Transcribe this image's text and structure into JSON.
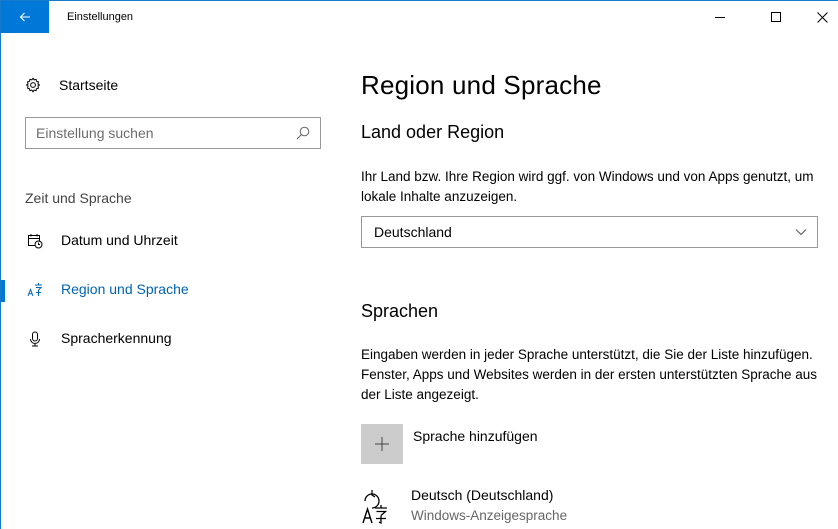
{
  "window": {
    "title": "Einstellungen",
    "accent_color": "#0078d7"
  },
  "icons": {
    "back": "back-arrow-icon",
    "home": "gear-icon",
    "search": "search-icon",
    "date": "calendar-clock-icon",
    "region": "language-region-icon",
    "speech": "microphone-icon",
    "add": "plus-icon",
    "dropdown": "chevron-down-icon",
    "language": "language-display-icon"
  },
  "sidebar": {
    "home_label": "Startseite",
    "search_placeholder": "Einstellung suchen",
    "section_label": "Zeit und Sprache",
    "items": [
      {
        "label": "Datum und Uhrzeit",
        "active": false
      },
      {
        "label": "Region und Sprache",
        "active": true
      },
      {
        "label": "Spracherkennung",
        "active": false
      }
    ]
  },
  "main": {
    "title": "Region und Sprache",
    "country": {
      "heading": "Land oder Region",
      "description": "Ihr Land bzw. Ihre Region wird ggf. von Windows und von Apps genutzt, um lokale Inhalte anzuzeigen.",
      "selected": "Deutschland"
    },
    "languages": {
      "heading": "Sprachen",
      "description": "Eingaben werden in jeder Sprache unterstützt, die Sie der Liste hinzufügen. Fenster, Apps und Websites werden in der ersten unterstützten Sprache aus der Liste angezeigt.",
      "add_label": "Sprache hinzufügen",
      "items": [
        {
          "name": "Deutsch (Deutschland)",
          "subtitle": "Windows-Anzeigesprache"
        }
      ]
    }
  }
}
